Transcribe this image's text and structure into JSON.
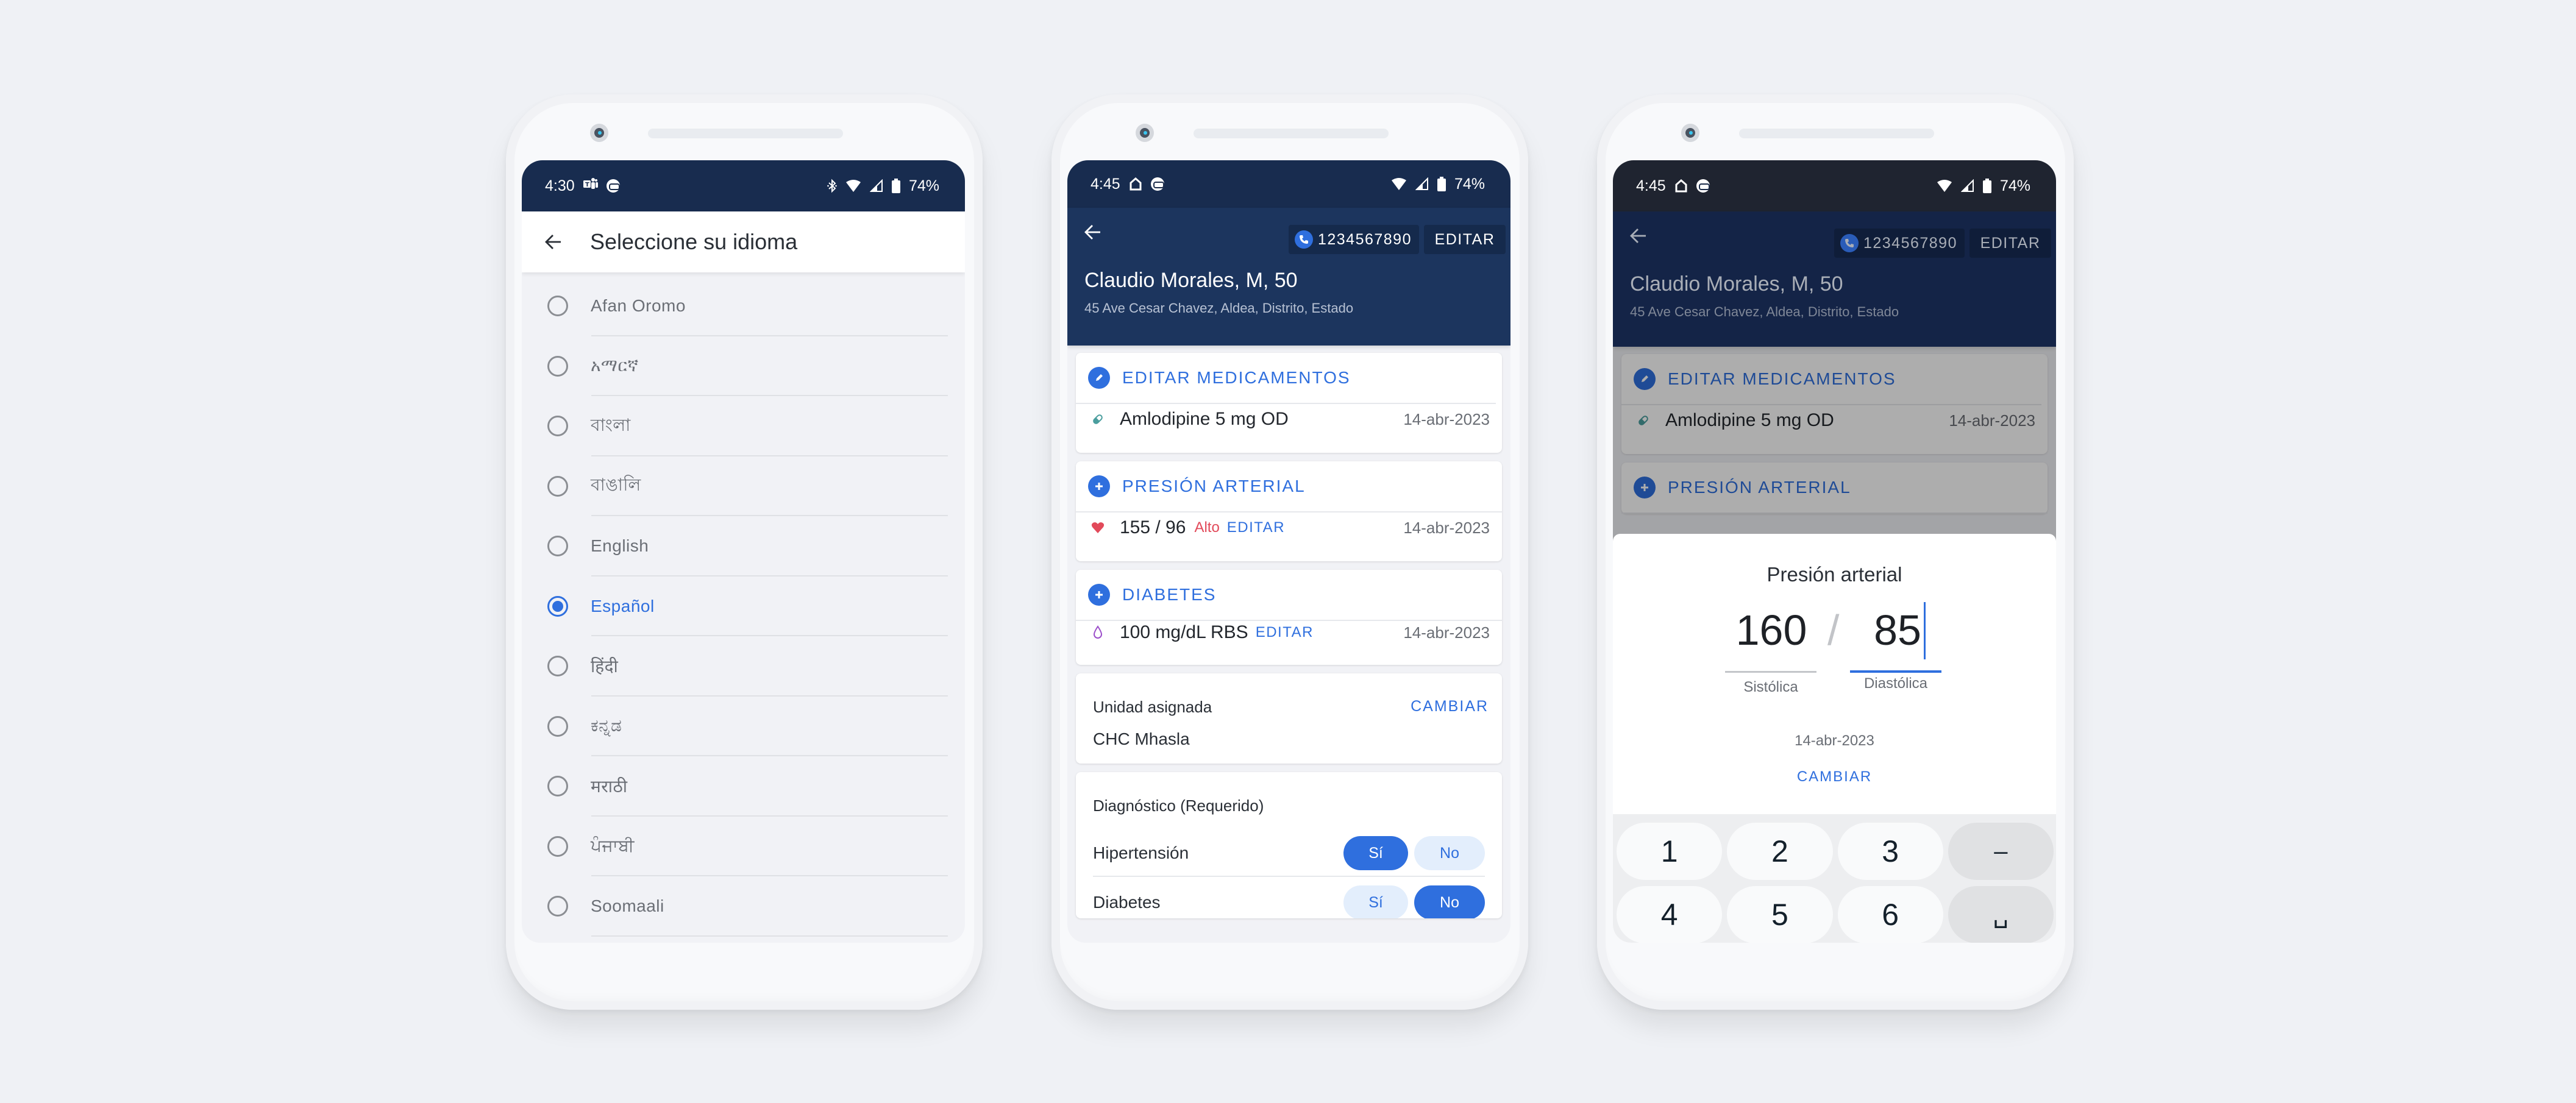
{
  "phone1": {
    "status": {
      "time": "4:30",
      "battery": "74%",
      "left_icons": [
        "teams-icon",
        "voicemail-icon"
      ],
      "right_icons": [
        "bluetooth-icon",
        "wifi-icon",
        "signal-icon",
        "battery-icon"
      ]
    },
    "appbar": {
      "title": "Seleccione su idioma",
      "back_icon": "arrow-back-icon"
    },
    "languages": [
      {
        "label": "Afan Oromo",
        "selected": false
      },
      {
        "label": "አማርኛ",
        "selected": false
      },
      {
        "label": "বাংলা",
        "selected": false
      },
      {
        "label": "বাঙালি",
        "selected": false
      },
      {
        "label": "English",
        "selected": false
      },
      {
        "label": "Español",
        "selected": true
      },
      {
        "label": "हिंदी",
        "selected": false
      },
      {
        "label": "ಕನ್ನಡ",
        "selected": false
      },
      {
        "label": "मराठी",
        "selected": false
      },
      {
        "label": "ਪੰਜਾਬੀ",
        "selected": false
      },
      {
        "label": "Soomaali",
        "selected": false
      }
    ]
  },
  "phone2": {
    "status": {
      "time": "4:45",
      "battery": "74%",
      "left_icons": [
        "home-icon",
        "voicemail-icon"
      ],
      "right_icons": [
        "wifi-icon",
        "signal-icon",
        "battery-icon"
      ]
    },
    "header": {
      "phone_number": "1234567890",
      "edit_label": "EDITAR",
      "patient_name": "Claudio Morales, M, 50",
      "address": "45 Ave Cesar Chavez, Aldea, Distrito, Estado"
    },
    "medications": {
      "title": "EDITAR MEDICAMENTOS",
      "item": "Amlodipine 5 mg OD",
      "date": "14-abr-2023"
    },
    "blood_pressure": {
      "title": "PRESIÓN ARTERIAL",
      "value": "155 / 96",
      "flag": "Alto",
      "edit_label": "EDITAR",
      "date": "14-abr-2023"
    },
    "diabetes": {
      "title": "DIABETES",
      "value": "100 mg/dL RBS",
      "edit_label": "EDITAR",
      "date": "14-abr-2023"
    },
    "facility": {
      "title": "Unidad asignada",
      "change_label": "CAMBIAR",
      "value": "CHC Mhasla"
    },
    "diagnosis": {
      "title": "Diagnóstico (Requerido)",
      "yes_label": "Sí",
      "no_label": "No",
      "rows": [
        {
          "label": "Hipertensión",
          "answer": "yes"
        },
        {
          "label": "Diabetes",
          "answer": "no"
        }
      ]
    }
  },
  "phone3": {
    "status": {
      "time": "4:45",
      "battery": "74%",
      "left_icons": [
        "home-icon",
        "voicemail-icon"
      ],
      "right_icons": [
        "wifi-icon",
        "signal-icon",
        "battery-icon"
      ]
    },
    "header": {
      "phone_number": "1234567890",
      "edit_label": "EDITAR",
      "patient_name": "Claudio Morales, M, 50",
      "address": "45 Ave Cesar Chavez, Aldea, Distrito, Estado"
    },
    "medications": {
      "title": "EDITAR MEDICAMENTOS",
      "item": "Amlodipine 5 mg OD",
      "date": "14-abr-2023"
    },
    "blood_pressure": {
      "title": "PRESIÓN ARTERIAL"
    },
    "sheet": {
      "title": "Presión arterial",
      "systolic": "160",
      "diastolic": "85",
      "separator": "/",
      "systolic_label": "Sistólica",
      "diastolic_label": "Diastólica",
      "date": "14-abr-2023",
      "change_label": "CAMBIAR"
    },
    "keypad": [
      "1",
      "2",
      "3",
      "–",
      "4",
      "5",
      "6",
      "␣"
    ]
  },
  "colors": {
    "accent": "#2f6fde",
    "alert": "#e24a5a",
    "navy_status": "#182c4f",
    "navy_header": "#1c355e",
    "pill_teal": "#4a9e9e",
    "drop_purple": "#9b4dca"
  }
}
